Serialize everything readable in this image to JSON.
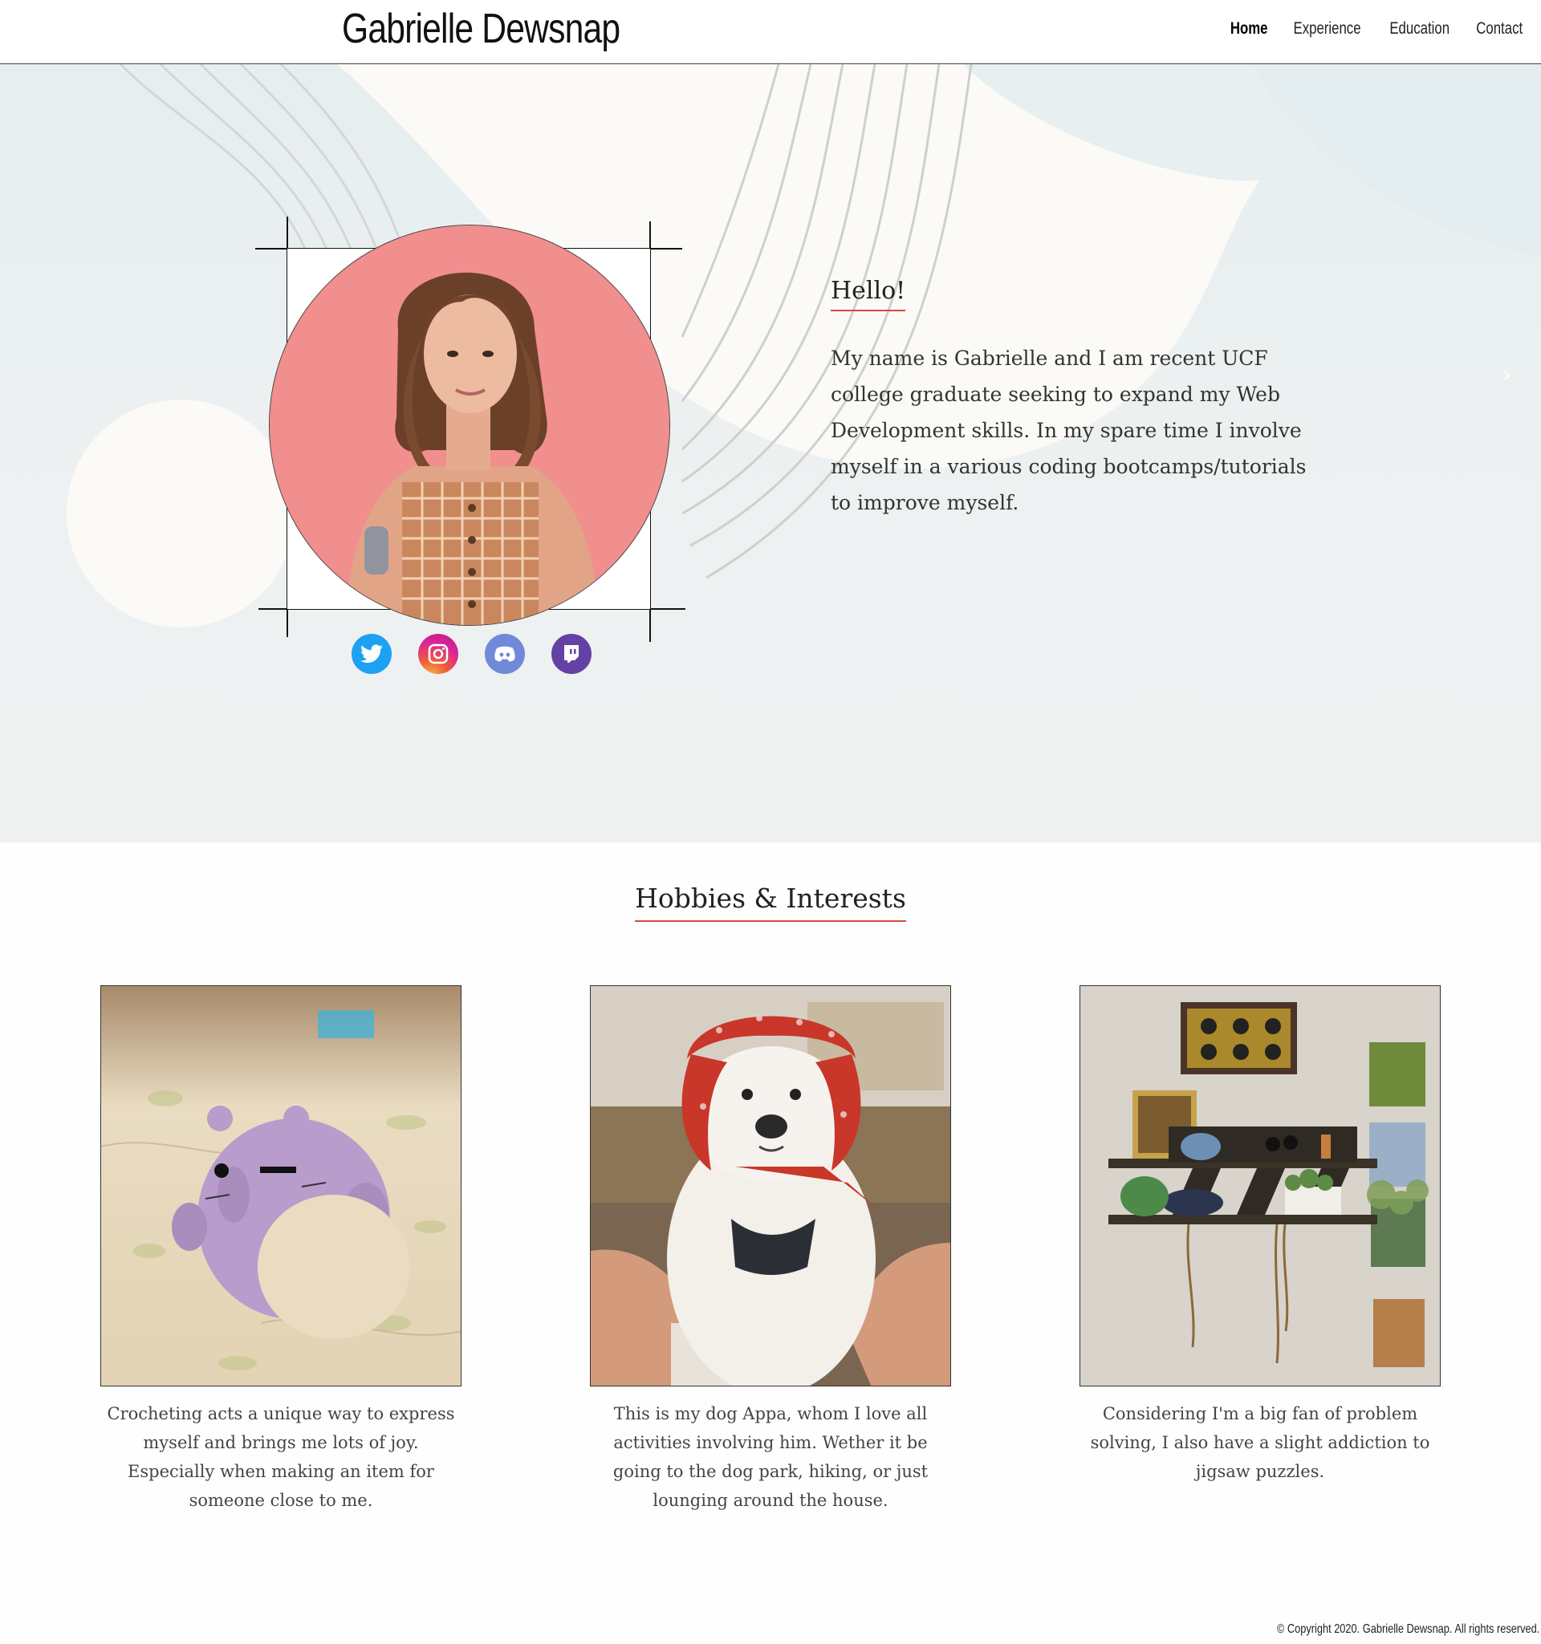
{
  "header": {
    "site_title": "Gabrielle Dewsnap",
    "nav": [
      "Home",
      "Experience",
      "Education",
      "Contact"
    ],
    "active": "Home"
  },
  "hero": {
    "heading": "Hello!",
    "intro": "My name is Gabrielle and I am recent UCF college graduate seeking to expand my Web Development skills. In my spare time I involve myself in a various coding bootcamps/tutorials to improve myself.",
    "carousel_next": "›",
    "socials": [
      "twitter-icon",
      "instagram-icon",
      "discord-icon",
      "twitch-icon"
    ]
  },
  "hobbies": {
    "title": "Hobbies & Interests",
    "cards": [
      {
        "caption": "Crocheting acts a unique way to express myself and brings me lots of joy. Especially when making an item for someone close to me."
      },
      {
        "caption": "This is my dog Appa, whom I love all activities involving him. Wether it be going to the dog park, hiking, or just lounging around the house."
      },
      {
        "caption": "Considering I'm a big fan of problem solving, I also have a slight addiction to jigsaw puzzles."
      }
    ]
  },
  "footer": {
    "copyright": "© Copyright 2020. Gabrielle Dewsnap. All rights reserved."
  },
  "colors": {
    "accent": "#d9473d",
    "portrait_bg": "#f18e8e",
    "twitter": "#1da1f2",
    "discord": "#7289da",
    "twitch": "#6441a5"
  }
}
